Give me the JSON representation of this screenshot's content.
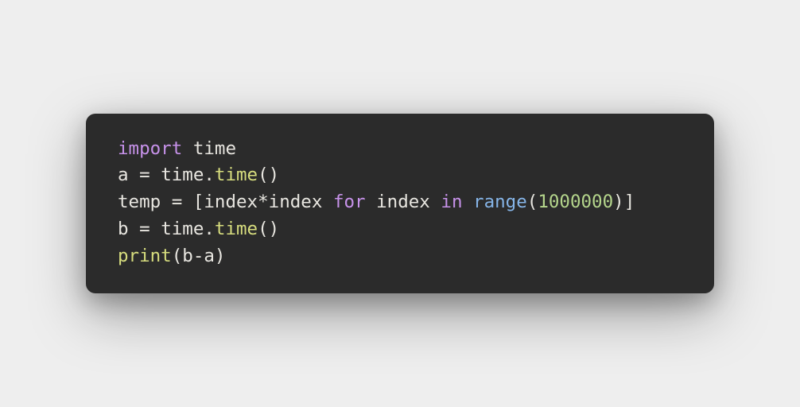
{
  "code": {
    "line1": {
      "import_kw": "import",
      "space": " ",
      "module": "time"
    },
    "line2": {
      "var": "a",
      "sp1": " ",
      "eq": "=",
      "sp2": " ",
      "obj": "time",
      "dot": ".",
      "method": "time",
      "parens": "()"
    },
    "line3": {
      "var": "temp",
      "sp1": " ",
      "eq": "=",
      "sp2": " ",
      "lbrack": "[",
      "expr1": "index",
      "star": "*",
      "expr2": "index",
      "sp3": " ",
      "for_kw": "for",
      "sp4": " ",
      "loopvar": "index",
      "sp5": " ",
      "in_kw": "in",
      "sp6": " ",
      "range_fn": "range",
      "lparen": "(",
      "number": "1000000",
      "rparen": ")",
      "rbrack": "]"
    },
    "line4": {
      "var": "b",
      "sp1": " ",
      "eq": "=",
      "sp2": " ",
      "obj": "time",
      "dot": ".",
      "method": "time",
      "parens": "()"
    },
    "line5": {
      "print_fn": "print",
      "lparen": "(",
      "arg1": "b",
      "minus": "-",
      "arg2": "a",
      "rparen": ")"
    }
  }
}
